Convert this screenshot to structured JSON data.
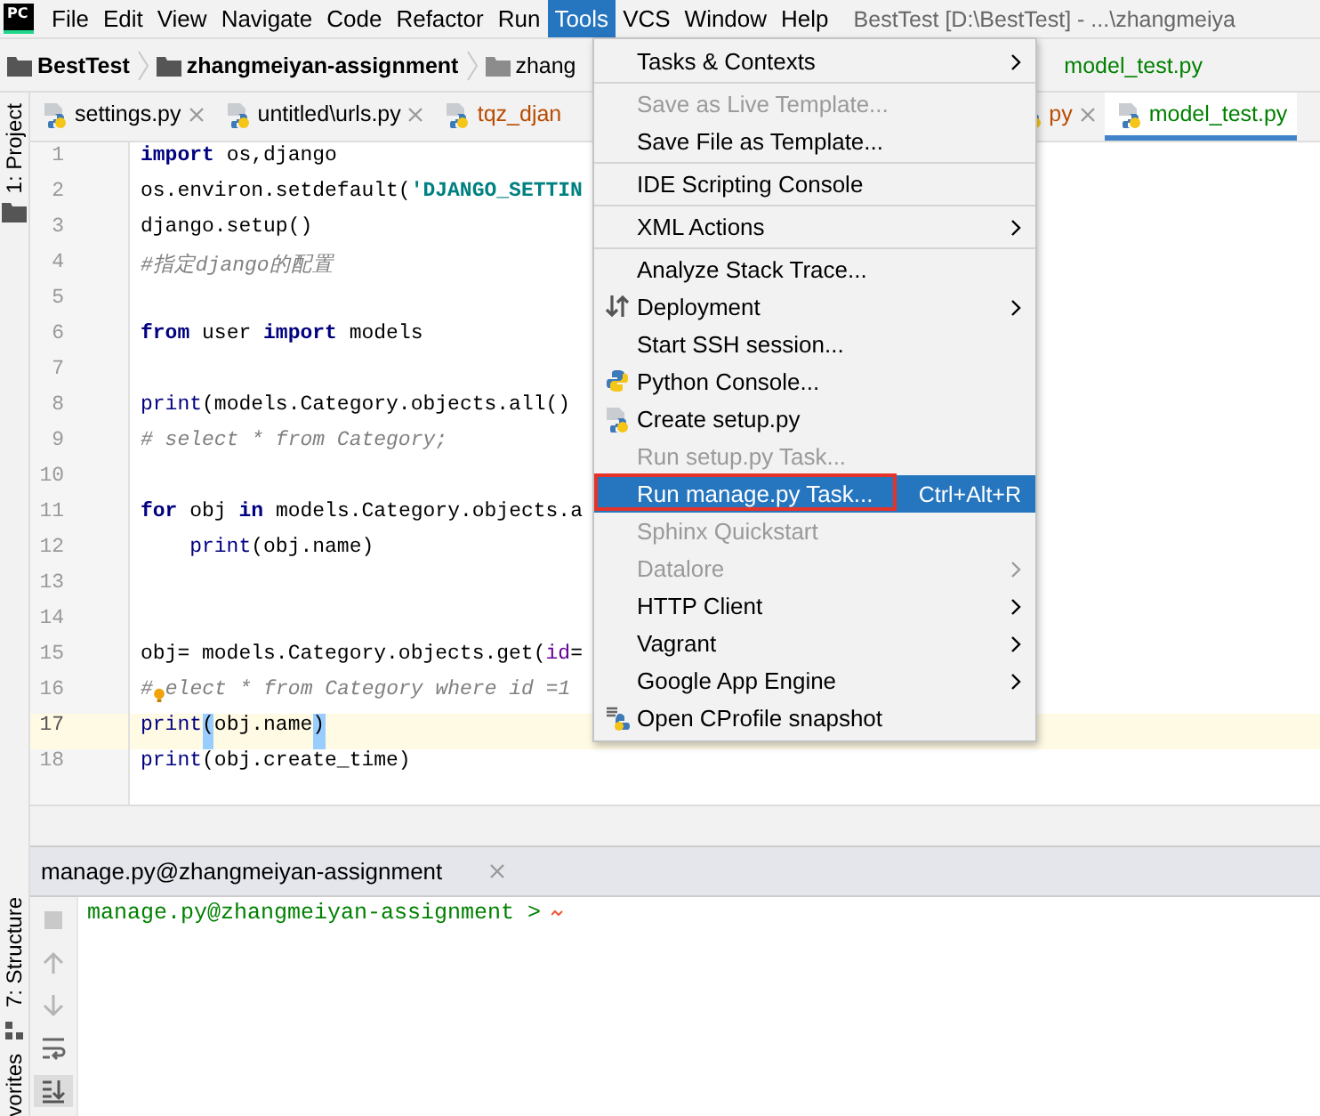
{
  "app": {
    "logo_text": "PC",
    "title": "BestTest [D:\\BestTest] - ...\\zhangmeiya"
  },
  "menu_bar": [
    {
      "label": "File",
      "selected": false
    },
    {
      "label": "Edit",
      "selected": false
    },
    {
      "label": "View",
      "selected": false
    },
    {
      "label": "Navigate",
      "selected": false
    },
    {
      "label": "Code",
      "selected": false
    },
    {
      "label": "Refactor",
      "selected": false
    },
    {
      "label": "Run",
      "selected": false
    },
    {
      "label": "Tools",
      "selected": true
    },
    {
      "label": "VCS",
      "selected": false
    },
    {
      "label": "Window",
      "selected": false
    },
    {
      "label": "Help",
      "selected": false
    }
  ],
  "navigation_bar": [
    {
      "kind": "project",
      "label": "BestTest"
    },
    {
      "kind": "module",
      "label": "zhangmeiyan-assignment"
    },
    {
      "kind": "folder",
      "label": "zhang"
    },
    {
      "kind": "file",
      "label": "model_test.py"
    }
  ],
  "tool_stripe": {
    "top": [
      {
        "label": "1: Project"
      }
    ],
    "bottom": [
      {
        "label": "7: Structure"
      },
      {
        "label": "vorites"
      }
    ]
  },
  "editor_tabs": [
    {
      "label": "settings.py",
      "selected": false,
      "color": "#000000",
      "closable": true
    },
    {
      "label": "untitled\\urls.py",
      "selected": false,
      "color": "#000000",
      "closable": true
    },
    {
      "label": "tqz_djan",
      "selected": false,
      "color": "#b84c00",
      "closable": false
    },
    {
      "label": "py",
      "selected": false,
      "color": "#b84c00",
      "closable": true
    },
    {
      "label": "model_test.py",
      "selected": true,
      "color": "#008000",
      "closable": false
    }
  ],
  "code_lines": [
    {
      "number": "1",
      "current": false,
      "segments": [
        {
          "kind": "keyword",
          "text": "import"
        },
        {
          "kind": "plain",
          "text": " os,django"
        }
      ]
    },
    {
      "number": "2",
      "current": false,
      "segments": [
        {
          "kind": "plain",
          "text": "os.environ.setdefault("
        },
        {
          "kind": "string",
          "text": "'DJANGO_SETTIN"
        }
      ]
    },
    {
      "number": "3",
      "current": false,
      "segments": [
        {
          "kind": "plain",
          "text": "django.setup()"
        }
      ]
    },
    {
      "number": "4",
      "current": false,
      "segments": [
        {
          "kind": "comment",
          "text": "#指定django的配置"
        }
      ]
    },
    {
      "number": "5",
      "current": false
    },
    {
      "number": "6",
      "current": false,
      "segments": [
        {
          "kind": "keyword",
          "text": "from"
        },
        {
          "kind": "plain",
          "text": " user "
        },
        {
          "kind": "keyword",
          "text": "import"
        },
        {
          "kind": "plain",
          "text": " models"
        }
      ]
    },
    {
      "number": "7",
      "current": false
    },
    {
      "number": "8",
      "current": false,
      "segments": [
        {
          "kind": "builtin",
          "text": "print"
        },
        {
          "kind": "plain",
          "text": "(models.Category.objects.all()"
        }
      ]
    },
    {
      "number": "9",
      "current": false,
      "segments": [
        {
          "kind": "comment",
          "text": "# select * from Category;"
        }
      ]
    },
    {
      "number": "10",
      "current": false
    },
    {
      "number": "11",
      "current": false,
      "segments": [
        {
          "kind": "keyword",
          "text": "for"
        },
        {
          "kind": "plain",
          "text": " obj "
        },
        {
          "kind": "keyword",
          "text": "in"
        },
        {
          "kind": "plain",
          "text": " models.Category.objects.a"
        }
      ]
    },
    {
      "number": "12",
      "current": false,
      "indent": true,
      "segments": [
        {
          "kind": "builtin",
          "text": "print"
        },
        {
          "kind": "plain",
          "text": "(obj.name)"
        }
      ]
    },
    {
      "number": "13",
      "current": false
    },
    {
      "number": "14",
      "current": false
    },
    {
      "number": "15",
      "current": false,
      "segments": [
        {
          "kind": "plain",
          "text": "obj= models.Category.objects.get("
        },
        {
          "kind": "param",
          "text": "id"
        },
        {
          "kind": "plain",
          "text": "="
        }
      ]
    },
    {
      "number": "16",
      "current": false,
      "segments": [
        {
          "kind": "comment",
          "text": "#"
        },
        {
          "kind": "bulb"
        },
        {
          "kind": "comment",
          "text": "elect * from Category where id =1"
        }
      ]
    },
    {
      "number": "17",
      "current": true,
      "segments": [
        {
          "kind": "builtin",
          "text": "print"
        },
        {
          "kind": "match",
          "text": "("
        },
        {
          "kind": "plain",
          "text": "obj.name"
        },
        {
          "kind": "match",
          "text": ")"
        }
      ]
    },
    {
      "number": "18",
      "current": false,
      "segments": [
        {
          "kind": "builtin",
          "text": "print"
        },
        {
          "kind": "plain",
          "text": "(obj.create_time)"
        }
      ]
    }
  ],
  "tools_menu": [
    {
      "label": "Tasks & Contexts",
      "submenu": true,
      "disabled": false,
      "selected": false
    },
    {
      "kind": "separator"
    },
    {
      "label": "Save as Live Template...",
      "disabled": true,
      "selected": false
    },
    {
      "label": "Save File as Template...",
      "disabled": false,
      "selected": false
    },
    {
      "kind": "separator"
    },
    {
      "label": "IDE Scripting Console",
      "disabled": false,
      "selected": false
    },
    {
      "kind": "separator"
    },
    {
      "label": "XML Actions",
      "submenu": true,
      "disabled": false,
      "selected": false
    },
    {
      "kind": "separator"
    },
    {
      "label": "Analyze Stack Trace...",
      "disabled": false,
      "selected": false
    },
    {
      "label": "Deployment",
      "kind": "arrows",
      "submenu": true,
      "disabled": false,
      "selected": false
    },
    {
      "label": "Start SSH session...",
      "disabled": false,
      "selected": false
    },
    {
      "label": "Python Console...",
      "kind": "python",
      "disabled": false,
      "selected": false
    },
    {
      "label": "Create setup.py",
      "kind": "pyfile",
      "disabled": false,
      "selected": false
    },
    {
      "label": "Run setup.py Task...",
      "disabled": true,
      "selected": false
    },
    {
      "label": "Run manage.py Task...",
      "shortcut": "Ctrl+Alt+R",
      "disabled": false,
      "selected": true,
      "annotated": true
    },
    {
      "label": "Sphinx Quickstart",
      "disabled": true,
      "selected": false
    },
    {
      "label": "Datalore",
      "submenu": true,
      "disabled": true,
      "selected": false
    },
    {
      "label": "HTTP Client",
      "submenu": true,
      "disabled": false,
      "selected": false
    },
    {
      "label": "Vagrant",
      "submenu": true,
      "disabled": false,
      "selected": false
    },
    {
      "label": "Google App Engine",
      "submenu": true,
      "disabled": false,
      "selected": false
    },
    {
      "label": "Open CProfile snapshot",
      "kind": "profile",
      "disabled": false,
      "selected": false
    }
  ],
  "run_console": {
    "tab": {
      "label": "manage.py@zhangmeiyan-assignment",
      "closable": true
    },
    "toolbar": [
      {
        "kind": "stop",
        "selected": false
      },
      {
        "kind": "up",
        "selected": false
      },
      {
        "kind": "down",
        "selected": false
      },
      {
        "kind": "wrap",
        "selected": false
      },
      {
        "kind": "scroll_end",
        "selected": true
      }
    ],
    "prompt": "manage.py@zhangmeiyan-assignment >"
  }
}
